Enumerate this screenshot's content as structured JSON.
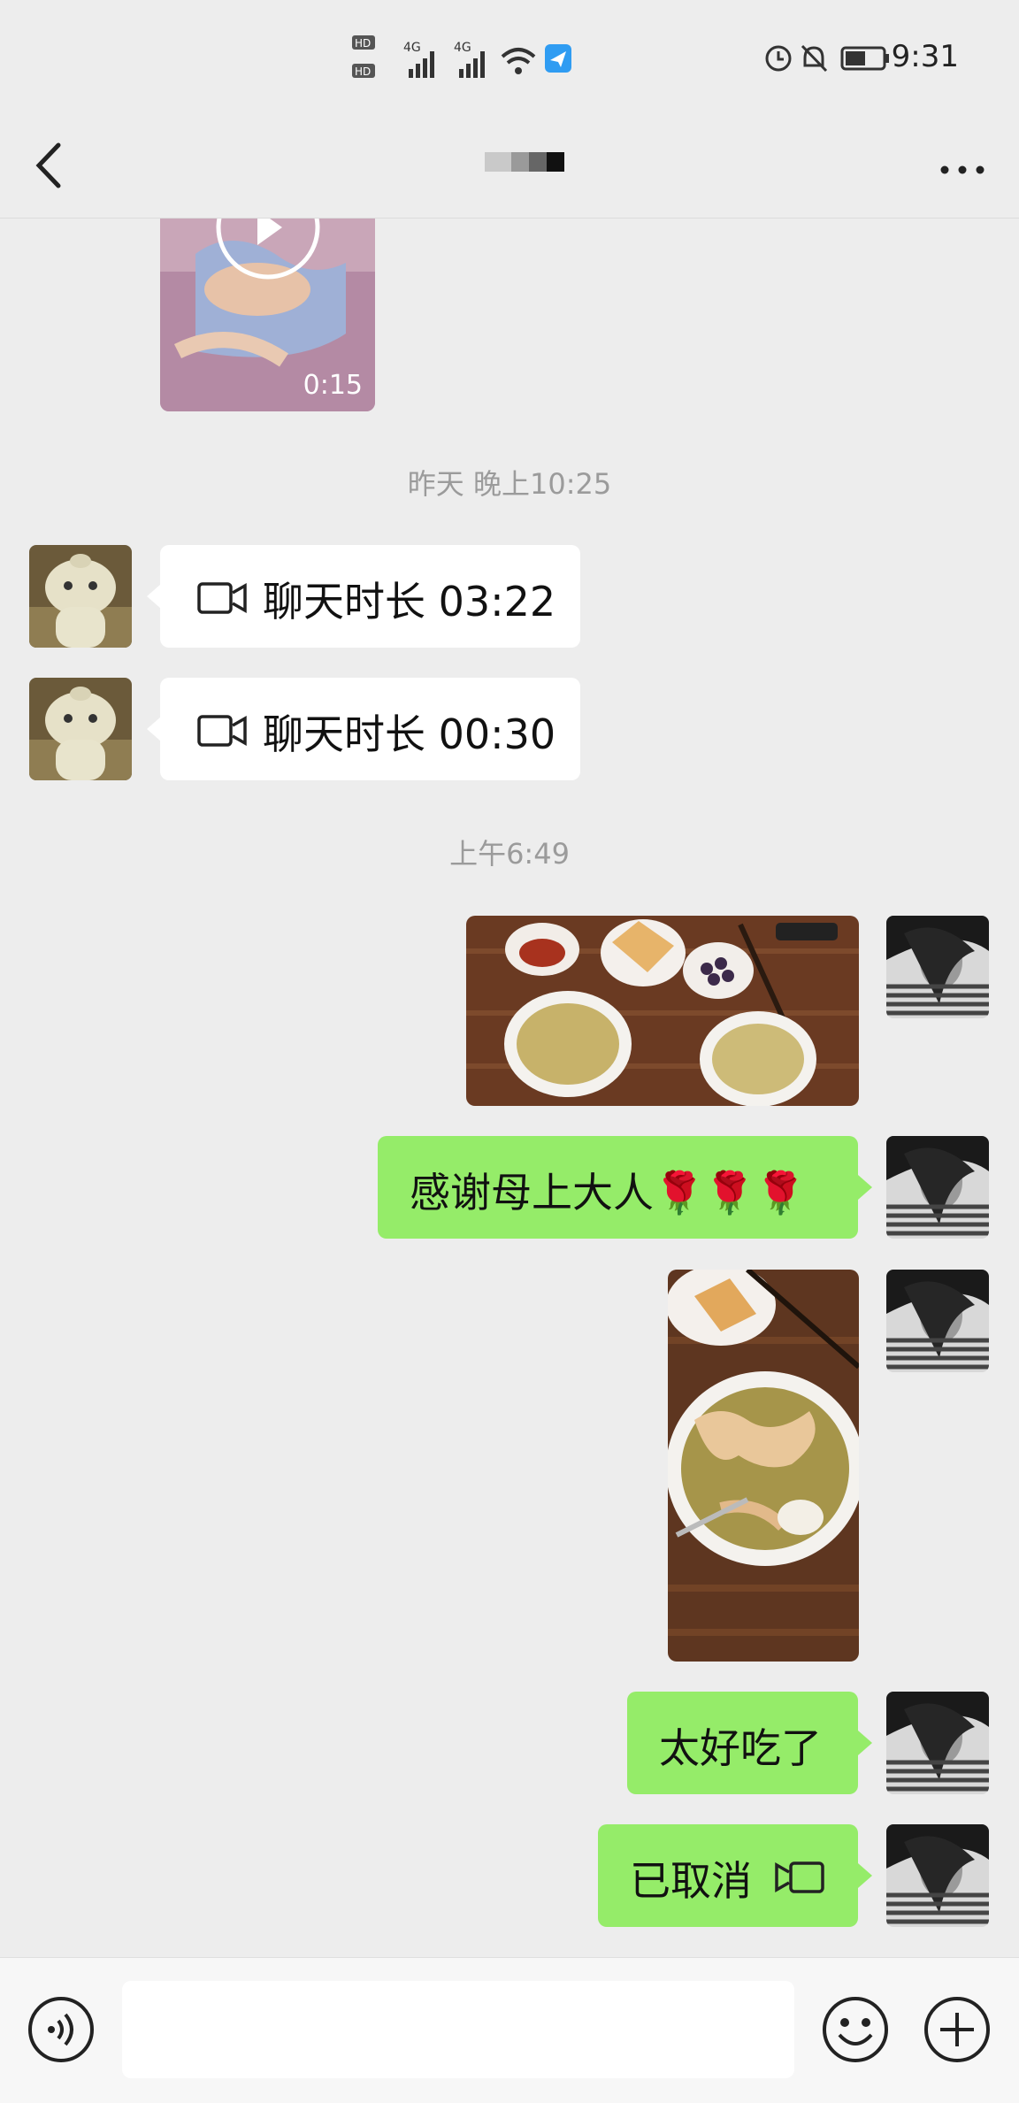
{
  "status_bar": {
    "time": "9:31",
    "signal_labels": [
      "HD1",
      "HD2",
      "4G",
      "4G"
    ]
  },
  "header": {
    "title": ""
  },
  "messages": {
    "video_duration": "0:15",
    "timestamp_1": "昨天 晚上10:25",
    "call_1": "聊天时长 03:22",
    "call_2": "聊天时长 00:30",
    "timestamp_2": "上午6:49",
    "text_1": "感谢母上大人🌹🌹🌹",
    "text_2": "太好吃了",
    "text_3": "已取消"
  },
  "input": {
    "placeholder": ""
  },
  "icons": {
    "back": "chevron-left-icon",
    "more": "more-dots-icon",
    "voice": "voice-icon",
    "emoji": "emoji-icon",
    "plus": "plus-icon",
    "video_call": "video-call-icon",
    "play": "play-icon"
  },
  "colors": {
    "background": "#ededed",
    "bubble_green": "#95ec69",
    "bubble_white": "#ffffff",
    "timestamp_gray": "#9b9b9b"
  }
}
